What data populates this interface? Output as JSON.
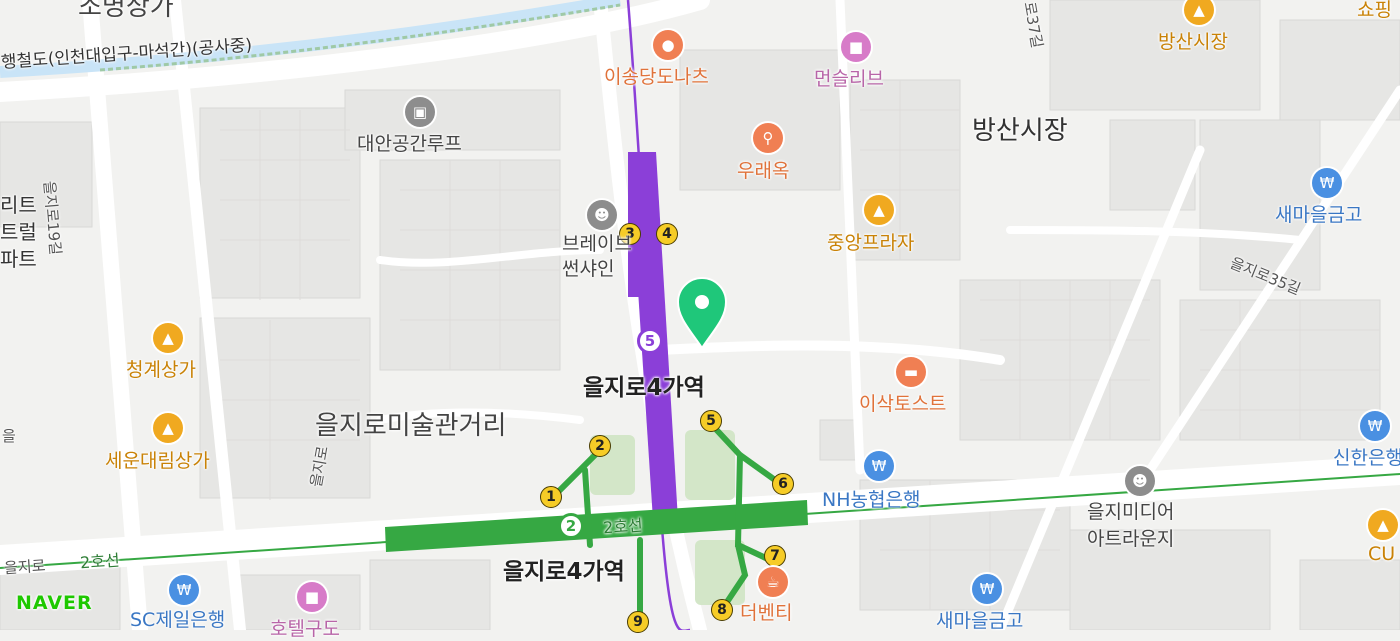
{
  "map": {
    "brand": "NAVER",
    "colors": {
      "line2": "#36a843",
      "line5": "#8b3fd8",
      "shopping": "#f0a920",
      "bank": "#4a90e2",
      "food": "#f07f53",
      "culture": "#8d8d8d",
      "hotel": "#d77bc8",
      "marker": "#1fc77a",
      "station_exit": "#f6cc27"
    },
    "stations": [
      {
        "id": "euljiro4-line5",
        "name": "을지로4가역",
        "line": "5"
      },
      {
        "id": "euljiro4-line2",
        "name": "을지로4가역",
        "line": "2"
      }
    ],
    "line_labels": {
      "line2": "2호선",
      "line2_west": "2호선",
      "line2_west_road": "을지로"
    },
    "exits_line5": [
      "3",
      "4",
      "5"
    ],
    "exits_line2": [
      "1",
      "2",
      "5",
      "6",
      "7",
      "8",
      "9"
    ],
    "areas": {
      "bangsan_market_area": "방산시장",
      "art_street": "을지로미술관거리",
      "top_left_partial": "조명상가",
      "left_partial": "리트\n트럴\n파트"
    },
    "roads": {
      "railway": "행철도(인천대입구-마석간)(공사중)",
      "euljiro19": "을지로19길",
      "euljiro35": "을지로35길",
      "road37": "로37길",
      "road_vertical": "을지로",
      "road_left_vertical": "을",
      "road_bottom_left": "을지로"
    },
    "pois": [
      {
        "name": "이송당도나츠",
        "type": "food",
        "icon": "donut-icon"
      },
      {
        "name": "먼슬리브",
        "type": "hotel",
        "icon": "bed-icon"
      },
      {
        "name": "방산시장",
        "type": "shopping",
        "icon": "shopping-bag-icon"
      },
      {
        "name": "대안공간루프",
        "type": "culture",
        "icon": "gallery-icon"
      },
      {
        "name": "우래옥",
        "type": "food",
        "icon": "restaurant-icon"
      },
      {
        "name": "새마을금고",
        "type": "bank",
        "icon": "won-icon"
      },
      {
        "name": "중앙프라자",
        "type": "shopping",
        "icon": "shopping-bag-icon"
      },
      {
        "name": "브레이브\n썬샤인",
        "type": "culture",
        "icon": "theater-mask-icon"
      },
      {
        "name": "청계상가",
        "type": "shopping",
        "icon": "shopping-bag-icon"
      },
      {
        "name": "이삭토스트",
        "type": "food",
        "icon": "burger-icon"
      },
      {
        "name": "세운대림상가",
        "type": "shopping",
        "icon": "shopping-bag-icon"
      },
      {
        "name": "신한은행",
        "type": "bank",
        "icon": "won-icon"
      },
      {
        "name": "NH농협은행",
        "type": "bank",
        "icon": "won-icon"
      },
      {
        "name": "을지미디어\n아트라운지",
        "type": "culture",
        "icon": "theater-mask-icon"
      },
      {
        "name": "CU",
        "type": "shopping",
        "icon": "shopping-bag-icon"
      },
      {
        "name": "SC제일은행",
        "type": "bank",
        "icon": "won-icon"
      },
      {
        "name": "호텔구도",
        "type": "hotel",
        "icon": "bed-icon"
      },
      {
        "name": "새마을금고",
        "type": "bank",
        "icon": "won-icon"
      },
      {
        "name": "더벤티",
        "type": "food",
        "icon": "coffee-icon"
      },
      {
        "name": "쇼핑",
        "type": "shopping",
        "icon": "shopping-bag-icon"
      }
    ]
  }
}
